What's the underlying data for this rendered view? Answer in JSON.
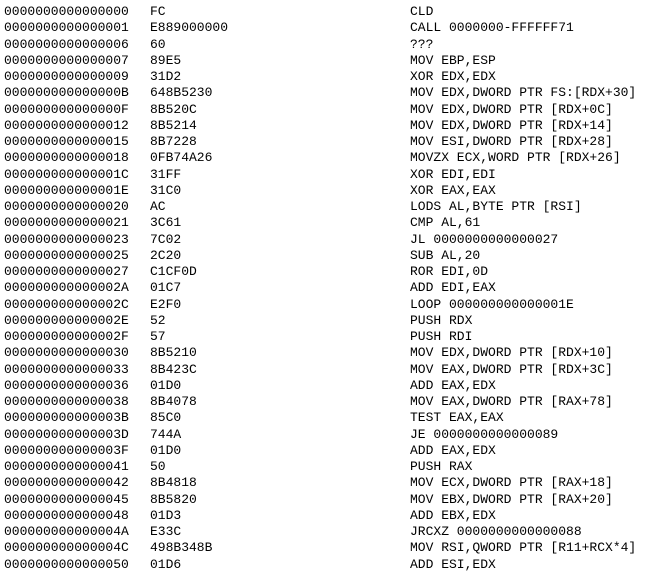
{
  "rows": [
    {
      "addr": "0000000000000000",
      "hex": "FC",
      "asm": "CLD"
    },
    {
      "addr": "0000000000000001",
      "hex": "E889000000",
      "asm": "CALL 0000000-FFFFFF71"
    },
    {
      "addr": "0000000000000006",
      "hex": "60",
      "asm": "???"
    },
    {
      "addr": "0000000000000007",
      "hex": "89E5",
      "asm": "MOV EBP,ESP"
    },
    {
      "addr": "0000000000000009",
      "hex": "31D2",
      "asm": "XOR EDX,EDX"
    },
    {
      "addr": "000000000000000B",
      "hex": "648B5230",
      "asm": "MOV EDX,DWORD PTR FS:[RDX+30]"
    },
    {
      "addr": "000000000000000F",
      "hex": "8B520C",
      "asm": "MOV EDX,DWORD PTR [RDX+0C]"
    },
    {
      "addr": "0000000000000012",
      "hex": "8B5214",
      "asm": "MOV EDX,DWORD PTR [RDX+14]"
    },
    {
      "addr": "0000000000000015",
      "hex": "8B7228",
      "asm": "MOV ESI,DWORD PTR [RDX+28]"
    },
    {
      "addr": "0000000000000018",
      "hex": "0FB74A26",
      "asm": "MOVZX ECX,WORD PTR [RDX+26]"
    },
    {
      "addr": "000000000000001C",
      "hex": "31FF",
      "asm": "XOR EDI,EDI"
    },
    {
      "addr": "000000000000001E",
      "hex": "31C0",
      "asm": "XOR EAX,EAX"
    },
    {
      "addr": "0000000000000020",
      "hex": "AC",
      "asm": "LODS AL,BYTE PTR [RSI]"
    },
    {
      "addr": "0000000000000021",
      "hex": "3C61",
      "asm": "CMP AL,61"
    },
    {
      "addr": "0000000000000023",
      "hex": "7C02",
      "asm": "JL 0000000000000027"
    },
    {
      "addr": "0000000000000025",
      "hex": "2C20",
      "asm": "SUB AL,20"
    },
    {
      "addr": "0000000000000027",
      "hex": "C1CF0D",
      "asm": "ROR EDI,0D"
    },
    {
      "addr": "000000000000002A",
      "hex": "01C7",
      "asm": "ADD EDI,EAX"
    },
    {
      "addr": "000000000000002C",
      "hex": "E2F0",
      "asm": "LOOP 000000000000001E"
    },
    {
      "addr": "000000000000002E",
      "hex": "52",
      "asm": "PUSH RDX"
    },
    {
      "addr": "000000000000002F",
      "hex": "57",
      "asm": "PUSH RDI"
    },
    {
      "addr": "0000000000000030",
      "hex": "8B5210",
      "asm": "MOV EDX,DWORD PTR [RDX+10]"
    },
    {
      "addr": "0000000000000033",
      "hex": "8B423C",
      "asm": "MOV EAX,DWORD PTR [RDX+3C]"
    },
    {
      "addr": "0000000000000036",
      "hex": "01D0",
      "asm": "ADD EAX,EDX"
    },
    {
      "addr": "0000000000000038",
      "hex": "8B4078",
      "asm": "MOV EAX,DWORD PTR [RAX+78]"
    },
    {
      "addr": "000000000000003B",
      "hex": "85C0",
      "asm": "TEST EAX,EAX"
    },
    {
      "addr": "000000000000003D",
      "hex": "744A",
      "asm": "JE 0000000000000089"
    },
    {
      "addr": "000000000000003F",
      "hex": "01D0",
      "asm": "ADD EAX,EDX"
    },
    {
      "addr": "0000000000000041",
      "hex": "50",
      "asm": "PUSH RAX"
    },
    {
      "addr": "0000000000000042",
      "hex": "8B4818",
      "asm": "MOV ECX,DWORD PTR [RAX+18]"
    },
    {
      "addr": "0000000000000045",
      "hex": "8B5820",
      "asm": "MOV EBX,DWORD PTR [RAX+20]"
    },
    {
      "addr": "0000000000000048",
      "hex": "01D3",
      "asm": "ADD EBX,EDX"
    },
    {
      "addr": "000000000000004A",
      "hex": "E33C",
      "asm": "JRCXZ 0000000000000088"
    },
    {
      "addr": "000000000000004C",
      "hex": "498B348B",
      "asm": "MOV RSI,QWORD PTR [R11+RCX*4]"
    },
    {
      "addr": "0000000000000050",
      "hex": "01D6",
      "asm": "ADD ESI,EDX"
    }
  ]
}
